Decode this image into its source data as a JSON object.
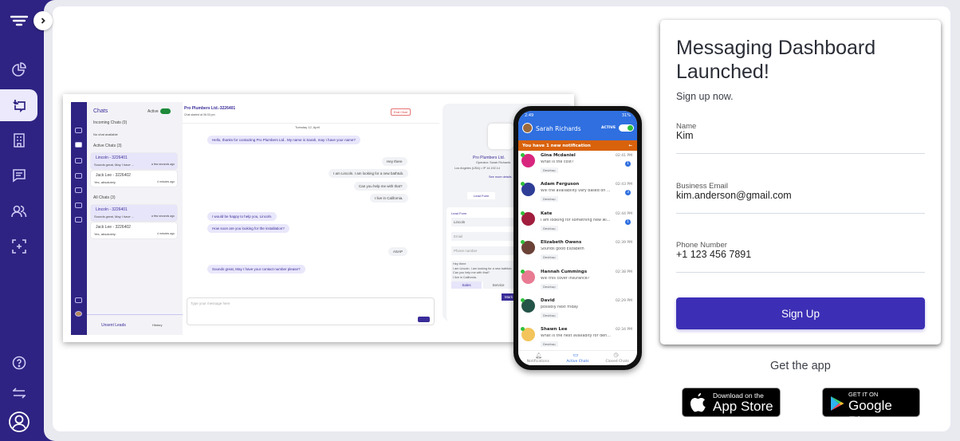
{
  "sidebar": {
    "items": [
      {
        "icon": "filter-icon"
      },
      {
        "icon": "pie-chart-icon"
      },
      {
        "icon": "chat-transfer-icon",
        "active": true
      },
      {
        "icon": "building-icon"
      },
      {
        "icon": "message-icon"
      },
      {
        "icon": "users-icon"
      },
      {
        "icon": "scan-add-icon"
      }
    ],
    "bottom": [
      {
        "icon": "help-icon"
      },
      {
        "icon": "swap-icon"
      },
      {
        "icon": "profile-icon"
      }
    ]
  },
  "mockup": {
    "chats_title": "Chats",
    "active_label": "Active",
    "incoming": "Incoming Chats (0)",
    "no_chat": "No chat available",
    "active_chats": "Active Chats (3)",
    "all_chats": "All Chats (3)",
    "chat1": {
      "name": "Lincoln - 3226401",
      "msg": "Sounds great, May I have ...",
      "time": "a few seconds ago"
    },
    "chat2": {
      "name": "Jack Lee - 3226402",
      "msg": "Yes, absolutely.",
      "time": "4 minutes ago"
    },
    "unsent": "Unsent Leads",
    "history": "History",
    "conv_title": "Pro Plumbers Ltd.-3226401",
    "conv_sub": "Chat started at 06:33 pm",
    "end_chat": "End Chat",
    "date": "Tuesday 12, April",
    "messages": [
      {
        "side": "l",
        "text": "Hello, thanks for contacting Pro Plumbers Ltd.. My name is Sarah, may I have your name?",
        "time": "7 minutes ago"
      },
      {
        "side": "r",
        "text": "Hey there"
      },
      {
        "side": "r",
        "text": "I am Lincoln. I am looking for a new bathtub."
      },
      {
        "side": "r",
        "text": "Can you help me with that?"
      },
      {
        "side": "r",
        "text": "I live in California.",
        "time": "4 minutes ago"
      },
      {
        "side": "l",
        "text": "I would be happy to help you, Lincoln."
      },
      {
        "side": "l",
        "text": "How soon are you looking for the installation?",
        "time": "3 minutes ago"
      },
      {
        "side": "r",
        "text": "ASAP",
        "time": "a few seconds ago"
      },
      {
        "side": "l",
        "text": "Sounds great, May I have your contact number please?",
        "time": "in a few seconds"
      }
    ],
    "input_placeholder": "Type your message here",
    "company": "Pro Plumbers Ltd.",
    "operator": "Operator: Sarah Richards",
    "location": "Los Angeles (USA) • IP 14.192.14",
    "see_more": "See more details",
    "lead_tab": "Lead Form",
    "lead_title": "Lead Form",
    "lead_name": "Lincoln",
    "email_ph": "Email",
    "phone_ph": "Phone number",
    "lead_notes": [
      "Hey there",
      "I am Lincoln. I am looking for a new bathtub.",
      "Can you help me with that?",
      "I live in California."
    ],
    "sales": "Sales",
    "service": "Service",
    "mark": "Mark"
  },
  "phone": {
    "time": "2:49",
    "battery": "31%",
    "user": "Sarah Richards",
    "status": "ACTIVE",
    "notification": "You have 1 new notification",
    "chats": [
      {
        "name": "Gina Mcdaniel",
        "msg": "What is the cost?",
        "time": "02:41 PM",
        "badge": "1",
        "color": "#d8267f"
      },
      {
        "name": "Adam Ferguson",
        "msg": "Will the availability vary based on c...",
        "time": "02:43 PM",
        "badge": "3",
        "color": "#2e3d96"
      },
      {
        "name": "Kate",
        "msg": "I am looking for something new wi...",
        "time": "02:44 PM",
        "badge": "1",
        "color": "#a11d3d"
      },
      {
        "name": "Elizabeth Owens",
        "msg": "Sounds good Elizabeth",
        "time": "02:39 PM",
        "color": "#6b4237"
      },
      {
        "name": "Hannah Cummings",
        "msg": "Will this cover insurance?",
        "time": "02:38 PM",
        "color": "#e87b92"
      },
      {
        "name": "David",
        "msg": "possibly next friday",
        "time": "02:29 PM",
        "color": "#245447"
      },
      {
        "name": "Shawn Lee",
        "msg": "What is the next availabity for dent...",
        "time": "02:34 PM",
        "color": "#f2c45b"
      }
    ],
    "tag": "Desktop",
    "nav": [
      "Notifications",
      "Active Chats",
      "Closed Chats"
    ]
  },
  "form": {
    "title": "Messaging Dashboard Launched!",
    "subtitle": "Sign up now.",
    "fields": [
      {
        "label": "Name",
        "value": "Kim"
      },
      {
        "label": "Business Email",
        "value": "kim.anderson@gmail.com"
      },
      {
        "label": "Phone Number",
        "value": "+1 123 456 7891"
      }
    ],
    "submit": "Sign Up",
    "accent": "#3c2fb5"
  },
  "apps": {
    "title": "Get the app",
    "appstore_top": "Download on the",
    "appstore": "App Store",
    "play_top": "GET IT ON",
    "play": "Google Play"
  }
}
